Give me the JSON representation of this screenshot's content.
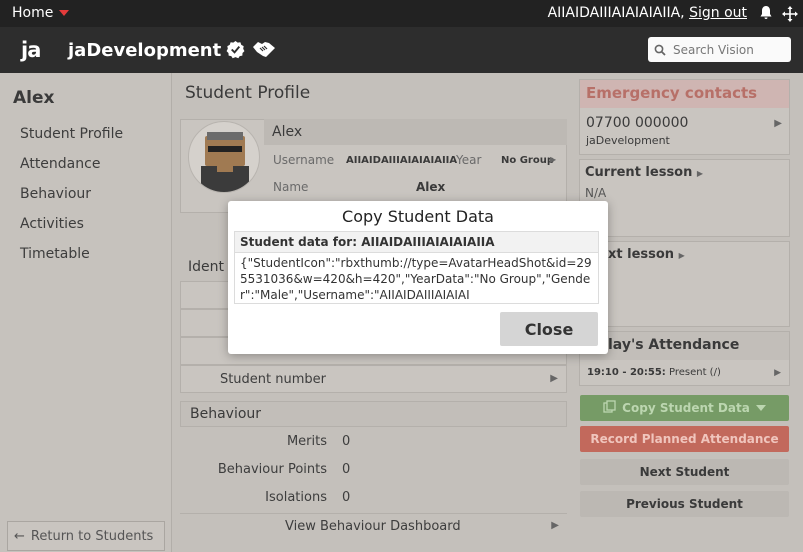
{
  "topbar": {
    "home_label": "Home",
    "username": "AIIAIDAIIIAIAIAIAIIA,",
    "signout_label": "Sign out"
  },
  "brand": {
    "logo_text": "ja",
    "org_name": "jaDevelopment",
    "search_placeholder": "Search Vision"
  },
  "sidebar": {
    "student_name": "Alex",
    "items": [
      {
        "label": "Student Profile"
      },
      {
        "label": "Attendance"
      },
      {
        "label": "Behaviour"
      },
      {
        "label": "Activities"
      },
      {
        "label": "Timetable"
      }
    ],
    "back_label": "Return to Students"
  },
  "main": {
    "title": "Student Profile",
    "profile": {
      "name": "Alex",
      "username_label": "Username",
      "username_value": "AIIAIDAIIIAIAIAIAIIA",
      "year_label": "Year",
      "year_value": "No Group",
      "name_label": "Name",
      "name_value": "Alex"
    },
    "identity": {
      "heading": "Ident",
      "student_number_label": "Student number"
    },
    "behaviour": {
      "heading": "Behaviour",
      "rows": [
        {
          "label": "Merits",
          "value": "0"
        },
        {
          "label": "Behaviour Points",
          "value": "0"
        },
        {
          "label": "Isolations",
          "value": "0"
        }
      ],
      "dashboard_label": "View Behaviour Dashboard"
    }
  },
  "right": {
    "emergency": {
      "heading": "Emergency contacts",
      "phone": "07700 000000",
      "org": "jaDevelopment"
    },
    "current_lesson": {
      "heading": "Current lesson",
      "value": "N/A"
    },
    "next_lesson": {
      "heading": "xt lesson"
    },
    "attendance": {
      "heading": "lay's Attendance",
      "time": "19:10 - 20:55:",
      "status": "Present (/)"
    },
    "buttons": {
      "copy": "Copy Student Data",
      "record": "Record Planned Attendance",
      "next": "Next Student",
      "previous": "Previous Student"
    }
  },
  "modal": {
    "title": "Copy Student Data",
    "header_label": "Student data for:",
    "header_name": "AIIAIDAIIIAIAIAIAIIA",
    "body": "{\"StudentIcon\":\"rbxthumb://type=AvatarHeadShot&id=295531036&w=420&h=420\",\"YearData\":\"No Group\",\"Gender\":\"Male\",\"Username\":\"AIIAIDAIIIAIAIAI",
    "close_label": "Close"
  },
  "colors": {
    "accent_red": "#e43b3b",
    "emergency_text": "#b77068",
    "copy_button": "#769b66",
    "record_button": "#c2695c"
  }
}
